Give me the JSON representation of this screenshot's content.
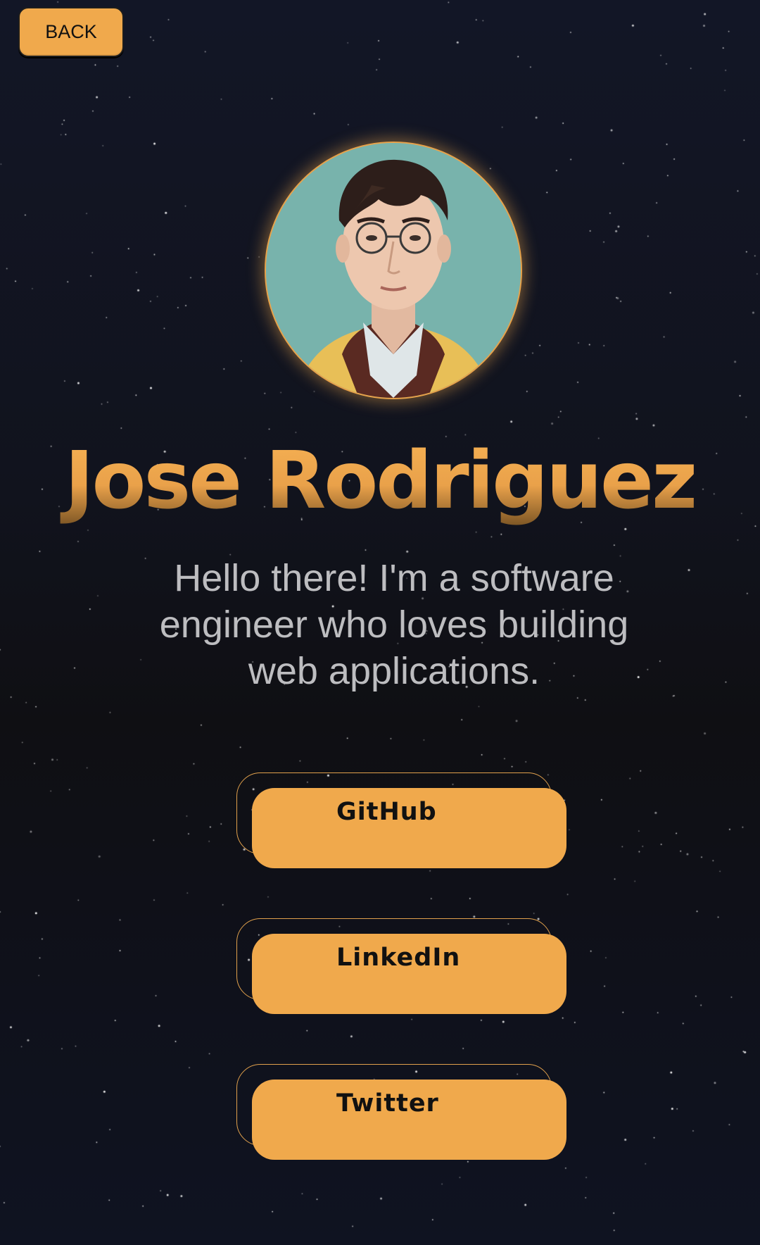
{
  "header": {
    "back_label": "BACK"
  },
  "profile": {
    "avatar_icon": "portrait-avatar",
    "name": "Jose Rodriguez",
    "bio": "Hello there! I'm a software engineer who loves building web applications."
  },
  "links": [
    {
      "label": "GitHub"
    },
    {
      "label": "LinkedIn"
    },
    {
      "label": "Twitter"
    }
  ],
  "colors": {
    "accent": "#f0a94c",
    "background": "#11131d",
    "bio_text": "#bdbdc0"
  }
}
